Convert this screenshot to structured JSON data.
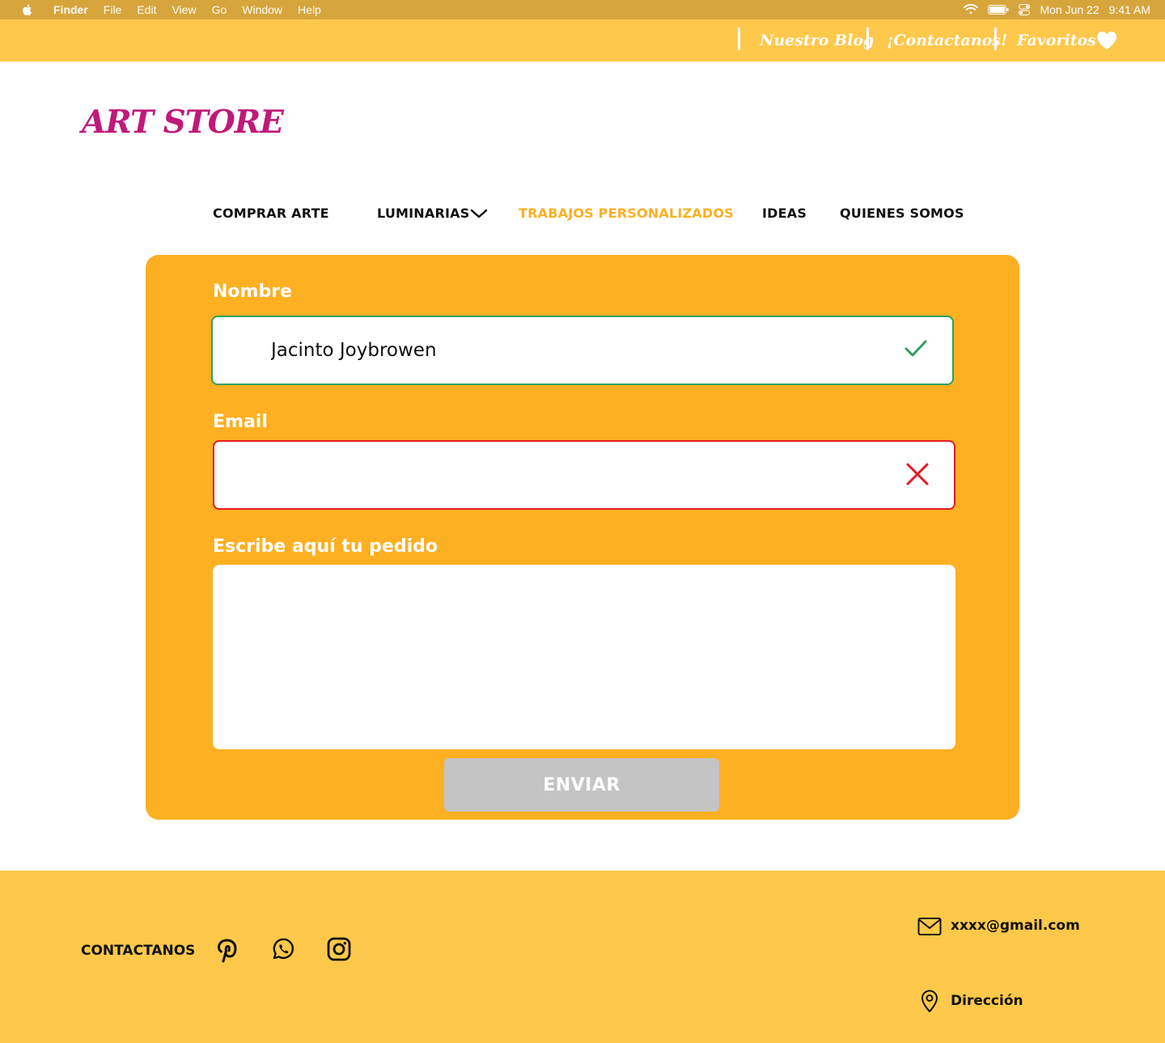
{
  "menubar": {
    "app_name": "Finder",
    "menus": [
      "File",
      "Edit",
      "View",
      "Go",
      "Window",
      "Help"
    ],
    "date": "Mon Jun 22",
    "time": "9:41 AM"
  },
  "topbar": {
    "links": [
      "Nuestro Blog",
      "¡Contactanos!",
      "Favoritos"
    ],
    "favorites_icon": "heart-icon"
  },
  "logo": "ART STORE",
  "nav": {
    "items": [
      {
        "label": "COMPRAR ARTE"
      },
      {
        "label": "LUMINARIAS"
      },
      {
        "label": "TRABAJOS PERSONALIZADOS"
      },
      {
        "label": "IDEAS"
      },
      {
        "label": "QUIENES SOMOS"
      }
    ],
    "active_color": "#FDB022"
  },
  "form": {
    "name_label": "Nombre",
    "name_value": "Jacinto Joybrowen",
    "name_status": "valid",
    "email_label": "Email",
    "email_value": "",
    "email_status": "invalid",
    "order_label": "Escribe aquí tu pedido",
    "order_value": "",
    "submit_label": "ENVIAR",
    "card_color": "#FDB022",
    "valid_color": "#32A05F",
    "invalid_color": "#E31B23"
  },
  "footer": {
    "contact_label": "CONTACTANOS",
    "social_icons": [
      "pinterest-icon",
      "whatsapp-icon",
      "instagram-icon"
    ],
    "email": "xxxx@gmail.com",
    "address": "Dirección"
  },
  "colors": {
    "topbar": "#FEC84B",
    "menubar": "#D6A63D",
    "logo": "#C0197A",
    "button_disabled": "#C4C4C4"
  }
}
